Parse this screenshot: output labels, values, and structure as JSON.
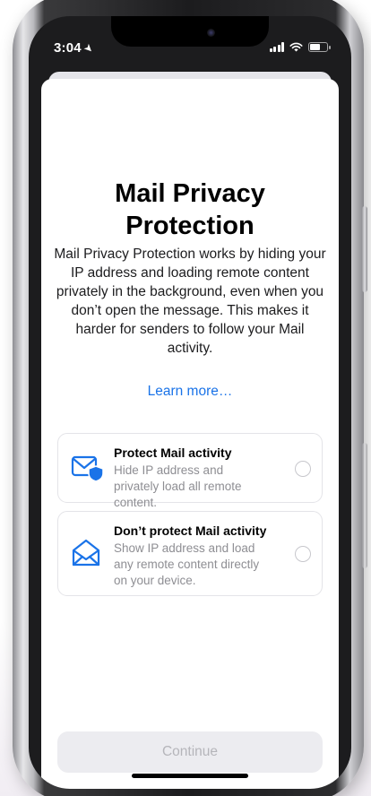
{
  "status_bar": {
    "time": "3:04",
    "location_icon": "location-arrow-icon",
    "signal_icon": "cellular-signal-icon",
    "wifi_icon": "wifi-icon",
    "battery_icon": "battery-icon"
  },
  "title": "Mail Privacy Protection",
  "description": "Mail Privacy Protection works by hiding your IP address and loading remote content privately in the background, even when you don’t open the message. This makes it harder for senders to follow your Mail activity.",
  "learn_more": "Learn more…",
  "options": [
    {
      "title": "Protect Mail activity",
      "subtitle": "Hide IP address and privately load all remote content.",
      "icon": "envelope-shield-icon",
      "selected": false
    },
    {
      "title": "Don’t protect Mail activity",
      "subtitle": "Show IP address and load any remote content directly on your device.",
      "icon": "open-envelope-icon",
      "selected": false
    }
  ],
  "continue_label": "Continue",
  "colors": {
    "accent": "#1a73e8",
    "disabled_button": "#ececf0",
    "disabled_text": "#b5b5ba"
  }
}
